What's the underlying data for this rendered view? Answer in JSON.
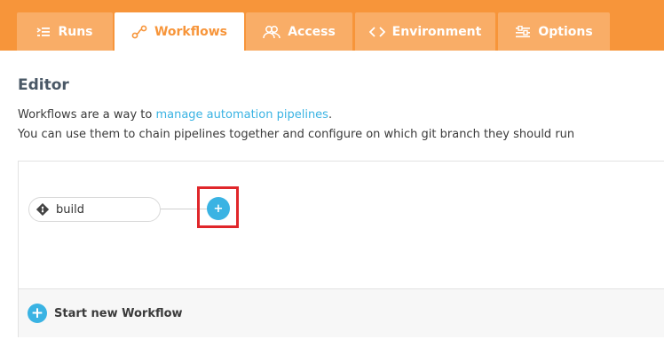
{
  "tabs": [
    {
      "label": "Runs",
      "icon": "list-icon",
      "active": false
    },
    {
      "label": "Workflows",
      "icon": "workflow-icon",
      "active": true
    },
    {
      "label": "Access",
      "icon": "users-icon",
      "active": false
    },
    {
      "label": "Environment",
      "icon": "code-icon",
      "active": false
    },
    {
      "label": "Options",
      "icon": "sliders-icon",
      "active": false
    }
  ],
  "colors": {
    "brand_orange": "#f7953a",
    "tab_inactive": "#f9ad67",
    "accent_blue": "#3ab3e3",
    "highlight_red": "#e0262a"
  },
  "editor": {
    "title": "Editor",
    "desc_prefix": "Workflows are a way to ",
    "desc_link": "manage automation pipelines",
    "desc_suffix": ".",
    "desc_line2": "You can use them to chain pipelines together and configure on which git branch they should run"
  },
  "workflow": {
    "node_label": "build",
    "node_icon": "git-icon",
    "add_label": "+"
  },
  "footer": {
    "start_label": "Start new Workflow",
    "plus_label": "+"
  }
}
